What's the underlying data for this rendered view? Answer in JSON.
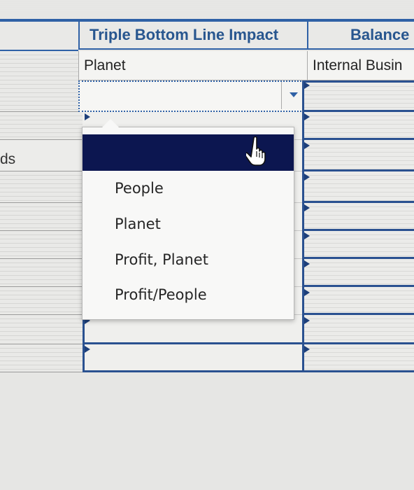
{
  "columns": {
    "triple_bottom_line": {
      "header": "Triple Bottom Line Impact",
      "value": "Planet"
    },
    "balance": {
      "header": "Balance",
      "value": "Internal Busin"
    }
  },
  "left_column": {
    "label": "ds"
  },
  "dropdown": {
    "selected_value": "",
    "options": [
      "People",
      "Planet",
      "Profit, Planet",
      "Profit/People"
    ]
  },
  "icons": {
    "dropdown_toggle": "chevron-down-icon",
    "pointer": "hand-pointer-icon"
  },
  "colors": {
    "header_blue": "#2f61a6",
    "selection_navy": "#0c1650",
    "border_blue": "#2a5190"
  }
}
